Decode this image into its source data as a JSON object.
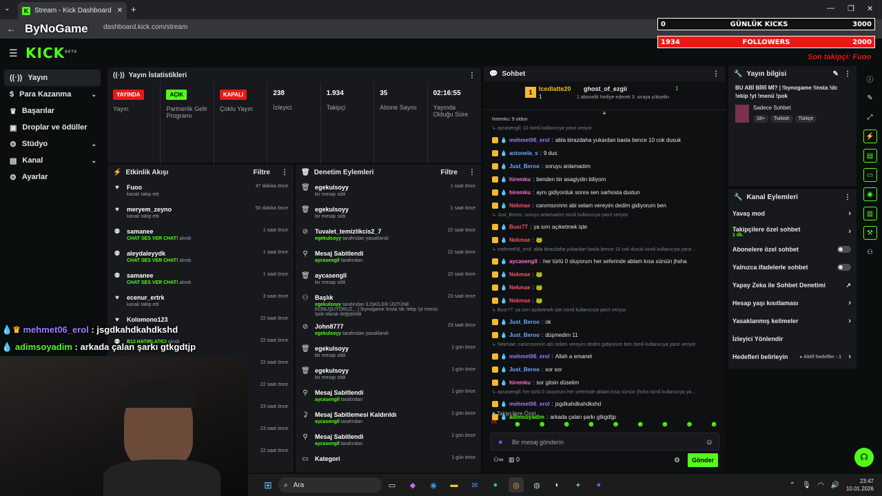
{
  "browser": {
    "tab_title": "Stream - Kick Dashboard",
    "url": "dashboard.kick.com/stream",
    "overlay_brand": "ByNoGame"
  },
  "logo": "KICK",
  "logo_beta": "BETA",
  "sidebar": {
    "items": [
      {
        "label": "Yayın",
        "icon": "broadcast-icon"
      },
      {
        "label": "Para Kazanma",
        "icon": "dollar-icon"
      },
      {
        "label": "Başarılar",
        "icon": "trophy-icon"
      },
      {
        "label": "Droplar ve ödüller",
        "icon": "gift-icon"
      },
      {
        "label": "Stüdyo",
        "icon": "settings-icon"
      },
      {
        "label": "Kanal",
        "icon": "book-icon"
      },
      {
        "label": "Ayarlar",
        "icon": "gear-icon"
      }
    ]
  },
  "stats": {
    "title": "Yayın İstatistikleri",
    "items": [
      {
        "badge": "YAYINDA",
        "label": "Yayın"
      },
      {
        "badge": "AÇIK",
        "label": "Partnerlik Gelir Programı"
      },
      {
        "badge": "KAPALI",
        "label": "Çoklu Yayın"
      },
      {
        "value": "238",
        "label": "İzleyici"
      },
      {
        "value": "1.934",
        "label": "Takipçi"
      },
      {
        "value": "35",
        "label": "Abone Sayısı"
      },
      {
        "value": "02:16:55",
        "label": "Yayında Olduğu Süre"
      }
    ]
  },
  "activity": {
    "title": "Etkinlik Akışı",
    "filter": "Filtre",
    "items": [
      {
        "name": "Fuoo",
        "sub": "kanalı takip etti",
        "time": "47 dakika önce"
      },
      {
        "name": "meryem_zeyno",
        "sub": "kanalı takip etti",
        "time": "50 dakika önce"
      },
      {
        "name": "samanee",
        "sub": "CHAT SES VER CHAT!",
        "sub2": "alındı",
        "time": "1 saat önce"
      },
      {
        "name": "aleydaleyydk",
        "sub": "CHAT SES VER CHAT!",
        "sub2": "alındı",
        "time": "1 saat önce"
      },
      {
        "name": "samanee",
        "sub": "CHAT SES VER CHAT!",
        "sub2": "alındı",
        "time": "1 saat önce"
      },
      {
        "name": "ecenur_ertrk",
        "sub": "kanalı takip etti",
        "time": "3 saat önce"
      },
      {
        "name": "Kolomono123",
        "sub": "",
        "time": "22 saat önce"
      },
      {
        "name": "",
        "sub": "B12 HATIRLATICI",
        "sub2": "alındı",
        "time": "22 saat önce"
      },
      {
        "time": "22 saat önce"
      },
      {
        "time": "22 saat önce"
      },
      {
        "time": "23 saat önce"
      },
      {
        "time": "23 saat önce"
      },
      {
        "time": "22 saat önce"
      }
    ]
  },
  "moderation": {
    "title": "Denetim Eylemleri",
    "filter": "Filtre",
    "items": [
      {
        "name": "egekulsoyy",
        "sub": "bir mesajı sildi",
        "time": "1 saat önce",
        "icon": "trash-icon"
      },
      {
        "name": "egekulsoyy",
        "sub": "bir mesajı sildi",
        "time": "1 saat önce",
        "icon": "trash-icon"
      },
      {
        "name": "Tuvalet_temizlikcis2_7",
        "sub": "egekulsoyy",
        "sub2": "tarafından yasaklandı",
        "time": "22 saat önce",
        "icon": "ban-icon"
      },
      {
        "name": "Mesaj Sabitlendi",
        "sub": "aycasengll",
        "sub2": "tarafından",
        "time": "22 saat önce",
        "icon": "pin-icon"
      },
      {
        "name": "aycasengll",
        "sub": "bir mesajı sildi",
        "time": "22 saat önce",
        "icon": "trash-icon"
      },
      {
        "name": "Başlık",
        "sub": "egekulsoyy",
        "sub2": "tarafından İLİŞKİLER ÜSTÜNE KONUŞUYORUZ... | !bynogame !insta !dc !ekip !yt !menü !pok olarak değiştirildi",
        "time": "23 saat önce",
        "icon": "users-icon"
      },
      {
        "name": "John8777",
        "sub": "egekulsoyy",
        "sub2": "tarafından yasaklandı",
        "time": "23 saat önce",
        "icon": "ban-icon"
      },
      {
        "name": "egekulsoyy",
        "sub": "bir mesajı sildi",
        "time": "1 gün önce",
        "icon": "trash-icon"
      },
      {
        "name": "egekulsoyy",
        "sub": "bir mesajı sildi",
        "time": "1 gün önce",
        "icon": "trash-icon"
      },
      {
        "name": "Mesaj Sabitlendi",
        "sub": "aycasengll",
        "sub2": "tarafından",
        "time": "1 gün önce",
        "icon": "pin-icon"
      },
      {
        "name": "Mesaj Sabitlemesi Kaldırıldı",
        "sub": "aycasengll",
        "sub2": "tarafından",
        "time": "1 gün önce",
        "icon": "unpin-icon"
      },
      {
        "name": "Mesaj Sabitlendi",
        "sub": "aycasengll",
        "sub2": "tarafından",
        "time": "1 gün önce",
        "icon": "pin-icon"
      },
      {
        "name": "Kategori",
        "sub": "",
        "time": "1 gün önce",
        "icon": "category-icon"
      }
    ]
  },
  "chat": {
    "title": "Sohbet",
    "pinned_user1": "Icedlatte20",
    "pinned_user1_count": "1",
    "pinned_user2": "ghost_of_ezgii",
    "pinned_user2_count": "1",
    "pinned_sub": "1 abonelik hediye ederek 3. sıraya yükselin",
    "first_line": "hiremku: 9 oldun",
    "lines": [
      {
        "t": "reply",
        "text": "aycasengll: 10 isimli kullanıcıya yanıt veriyor"
      },
      {
        "t": "msg",
        "user": "mehmet06_erol",
        "color": "#9e7cff",
        "text": "abla birazdaha yukardan basla bence 10 cok dusuk"
      },
      {
        "t": "msg",
        "user": "antonela_s",
        "color": "#6ea8ff",
        "text": "9 dus"
      },
      {
        "t": "msg",
        "user": "Just_Beroo",
        "color": "#6ea8ff",
        "text": "soruyu anlamadım"
      },
      {
        "t": "msg",
        "user": "hiremku",
        "color": "#ff6ed1",
        "text": "benden bir asagiydin biliyom"
      },
      {
        "t": "msg",
        "user": "hiremku",
        "color": "#ff6ed1",
        "text": "aynı gidiyorduk sonra sen sarhosta dustun"
      },
      {
        "t": "msg",
        "user": "Nekmae",
        "color": "#ff4d6a",
        "text": "canımsınnnn abi selam vereyim dedim gidiyorum ben"
      },
      {
        "t": "reply",
        "text": "Just_Beroo: soruyu anlamadım isimli kullanıcıya yanıt veriyor"
      },
      {
        "t": "msg",
        "user": "Busr77",
        "color": "#ff4d6a",
        "text": "ya sırrı açıketmek işte"
      },
      {
        "t": "msg",
        "user": "Nekmae",
        "color": "#ff4d6a",
        "text": "🐸"
      },
      {
        "t": "reply",
        "text": "mehmet06_erol: abla birazdaha yukardan basla bence 10 cok dusuk isimli kullanıcıya yanıt ..."
      },
      {
        "t": "msg",
        "user": "aycasengll",
        "color": "#ff6ed1",
        "text": "her türlü 0 oluyorum her seferinde ablam kısa sürsün jhsha"
      },
      {
        "t": "msg",
        "user": "Nekmae",
        "color": "#ff4d6a",
        "text": "🐸"
      },
      {
        "t": "msg",
        "user": "Nekmae",
        "color": "#ff4d6a",
        "text": "🐸"
      },
      {
        "t": "msg",
        "user": "Nekmae",
        "color": "#ff4d6a",
        "text": "🐸"
      },
      {
        "t": "reply",
        "text": "Busr77: ya sırrı açıketmek işte isimli kullanıcıya yanıt veriyor"
      },
      {
        "t": "msg",
        "user": "Just_Beroo",
        "color": "#6ea8ff",
        "text": "ok"
      },
      {
        "t": "msg",
        "user": "Just_Beroo",
        "color": "#6ea8ff",
        "text": "düşmedim 11"
      },
      {
        "t": "reply",
        "text": "Nekmae: canımsınnnn abi selam vereyim dedim gidiyorum ben isimli kullanıcıya yanıt veriyor"
      },
      {
        "t": "msg",
        "user": "mehmet06_erol",
        "color": "#9e7cff",
        "text": "Allah a emanet"
      },
      {
        "t": "msg",
        "user": "Just_Beroo",
        "color": "#6ea8ff",
        "text": "sor sor"
      },
      {
        "t": "msg",
        "user": "hiremku",
        "color": "#ff6ed1",
        "text": "sor gitsin düselim"
      },
      {
        "t": "reply",
        "text": "aycasengll: her türlü 0 oluyorum her seferinde ablam kısa sürsün jhsha isimli kullanıcıya ya..."
      },
      {
        "t": "msg",
        "user": "mehmet06_erol",
        "color": "#9e7cff",
        "text": "jsgdkahdkahdkshd"
      },
      {
        "t": "msg",
        "user": "adimsoyadim",
        "color": "#53fc18",
        "text": "arkada çalan şarkı gtkgdtjp"
      }
    ],
    "followers_only": "Takipçilere Özel",
    "input_placeholder": "Bir mesaj gönderin",
    "viewers_icon_count": "0",
    "send": "Gönder"
  },
  "stream_info": {
    "title": "Yayın bilgisi",
    "stream_title": "BU ABİ BİRİ Mİ? | !bynogame !insta !dc !ekip !yt !menü !pok",
    "category": "Sadece Sohbet",
    "tags": [
      "18+",
      "Turkish",
      "Türkçe"
    ]
  },
  "channel_actions": {
    "title": "Kanal Eylemleri",
    "items": [
      {
        "label": "Yavaş mod",
        "kind": "chev"
      },
      {
        "label": "Takipçilere özel sohbet",
        "sub": "1 dk.",
        "kind": "chev"
      },
      {
        "label": "Abonelere özel sohbet",
        "kind": "toggle"
      },
      {
        "label": "Yalnızca ifadelerle sohbet",
        "kind": "toggle"
      },
      {
        "label": "Yapay Zeka ile Sohbet Denetimi",
        "kind": "ext"
      },
      {
        "label": "Hesap yaşı kısıtlaması",
        "kind": "chev"
      },
      {
        "label": "Yasaklanmış kelimeler",
        "kind": "chev"
      },
      {
        "label": "İzleyici Yönlendir",
        "kind": "none"
      },
      {
        "label": "Hedefleri belirleyin",
        "sub": "Aktif hedefler - 1",
        "kind": "chev"
      }
    ]
  },
  "overlay": {
    "kicks_label": "GÜNLÜK KICKS",
    "kicks_value": "0",
    "kicks_goal": "3000",
    "followers_label": "FOLLOWERS",
    "followers_value": "1934",
    "followers_goal": "2000",
    "last_follower": "Son takipçi: Fuoo",
    "chat1_user": "mehmet06_erol",
    "chat1_text": "jsgdkahdkahdkshd",
    "chat2_user": "adimsoyadim",
    "chat2_text": "arkada çalan şarkı gtkgdtjp"
  },
  "taskbar": {
    "search": "Ara",
    "time": "23:47",
    "date": "10.01.2026"
  },
  "colors": {
    "kick_green": "#53fc18",
    "live_red": "#e91916",
    "panel": "#17191c"
  }
}
